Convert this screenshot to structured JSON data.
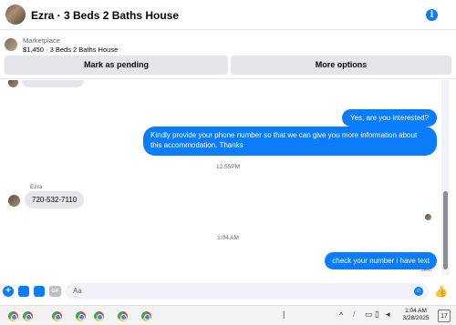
{
  "header": {
    "title": "Ezra · 3 Beds 2 Baths House",
    "info_icon": "info-icon",
    "accent": "#0a7cff"
  },
  "marketplace": {
    "label": "Marketplace",
    "listing": "$1,450 · 3 Beds 2 Baths House",
    "buttons": {
      "pending": "Mark as pending",
      "more": "More options"
    }
  },
  "messages": [
    {
      "from": "me",
      "text": "Yes, are you interested?"
    },
    {
      "from": "me",
      "text": "Kindly provide your phone number so that we can give you more information about this accommodation. Thanks"
    },
    {
      "timestamp": "12:55PM"
    },
    {
      "from": "Ezra",
      "sender_label": "Ezra",
      "text": "720-532-7110"
    },
    {
      "timestamp": "1:04 AM"
    },
    {
      "from": "me",
      "text": "check your number i have text",
      "status": "Sent"
    }
  ],
  "composer": {
    "placeholder": "Aa",
    "gif_label": "GIF",
    "icons": [
      "plus-icon",
      "photo-icon",
      "sticker-icon",
      "gif-icon",
      "emoji-icon",
      "like-icon"
    ]
  },
  "taskbar": {
    "time": "1:04 AM",
    "date": "3/28/2025",
    "notifications": "17",
    "app_icons": [
      "chrome-icon",
      "chrome-icon",
      "chrome-icon",
      "chrome-icon",
      "chrome-icon",
      "chrome-icon",
      "chrome-icon"
    ]
  }
}
